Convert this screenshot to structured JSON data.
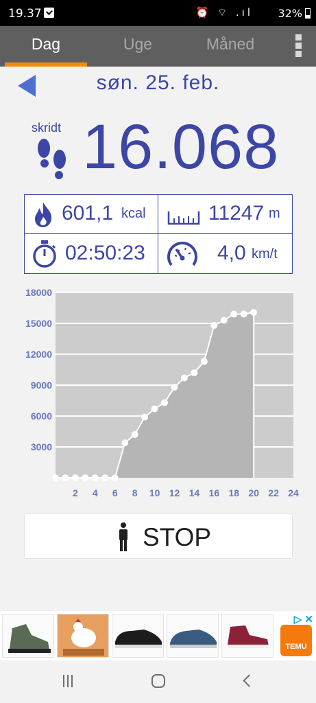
{
  "status_bar": {
    "time": "19.37",
    "icons": "⏰ ⌔ .ıl",
    "battery": "32%"
  },
  "tabs": [
    {
      "label": "Dag",
      "active": true
    },
    {
      "label": "Uge",
      "active": false
    },
    {
      "label": "Måned",
      "active": false
    }
  ],
  "header": {
    "date": "søn. 25. feb."
  },
  "steps": {
    "label": "skridt",
    "value": "16.068"
  },
  "stats": {
    "calories": {
      "value": "601,1",
      "unit": "kcal"
    },
    "distance": {
      "value": "11247",
      "unit": "m"
    },
    "duration": {
      "value": "02:50:23"
    },
    "speed": {
      "value": "4,0",
      "unit": "km/t"
    }
  },
  "colors": {
    "accent": "#3c46a5",
    "tab_indicator": "#f58a0b",
    "tab_bar": "#5f5f5f",
    "chart_bg": "#cccccc",
    "chart_fill": "#b5b5b5"
  },
  "chart_data": {
    "type": "area",
    "x": [
      0,
      1,
      2,
      3,
      4,
      5,
      6,
      7,
      8,
      9,
      10,
      11,
      12,
      13,
      14,
      15,
      16,
      17,
      18,
      19,
      20
    ],
    "values": [
      0,
      0,
      0,
      0,
      0,
      0,
      0,
      3400,
      4200,
      5900,
      6700,
      7300,
      8800,
      9700,
      10200,
      11300,
      14800,
      15300,
      15900,
      15900,
      16068
    ],
    "xticks": [
      2,
      4,
      6,
      8,
      10,
      12,
      14,
      16,
      18,
      20,
      22,
      24
    ],
    "yticks": [
      3000,
      6000,
      9000,
      12000,
      15000,
      18000
    ],
    "xlim": [
      0,
      24
    ],
    "ylim": [
      0,
      18000
    ],
    "grid": true
  },
  "stop_button": {
    "label": "STOP"
  },
  "ad": {
    "choices": "▷ ✕",
    "brand": "TEMU"
  }
}
